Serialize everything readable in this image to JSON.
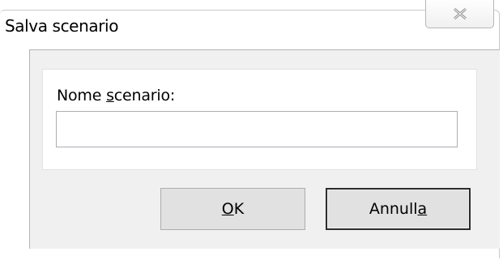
{
  "window": {
    "title": "Salva scenario",
    "close_icon": "close-x-icon"
  },
  "form": {
    "label_pre": "Nome ",
    "label_accel": "s",
    "label_post": "cenario:",
    "name_value": ""
  },
  "buttons": {
    "ok_accel": "O",
    "ok_rest": "K",
    "cancel_pre": "Annull",
    "cancel_accel": "a"
  },
  "colors": {
    "client_bg": "#f0f0f0",
    "button_bg": "#e1e1e1",
    "default_button_border": "#2d2d2d"
  }
}
